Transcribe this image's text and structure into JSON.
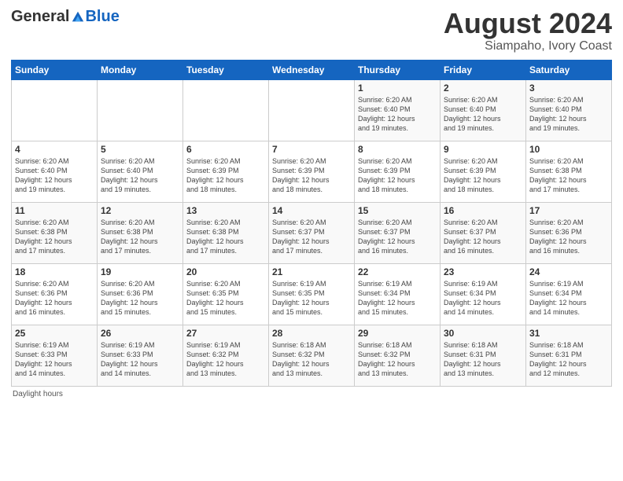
{
  "header": {
    "logo_general": "General",
    "logo_blue": "Blue",
    "month_title": "August 2024",
    "location": "Siampaho, Ivory Coast"
  },
  "days_of_week": [
    "Sunday",
    "Monday",
    "Tuesday",
    "Wednesday",
    "Thursday",
    "Friday",
    "Saturday"
  ],
  "weeks": [
    [
      {
        "day": "",
        "info": ""
      },
      {
        "day": "",
        "info": ""
      },
      {
        "day": "",
        "info": ""
      },
      {
        "day": "",
        "info": ""
      },
      {
        "day": "1",
        "info": "Sunrise: 6:20 AM\nSunset: 6:40 PM\nDaylight: 12 hours\nand 19 minutes."
      },
      {
        "day": "2",
        "info": "Sunrise: 6:20 AM\nSunset: 6:40 PM\nDaylight: 12 hours\nand 19 minutes."
      },
      {
        "day": "3",
        "info": "Sunrise: 6:20 AM\nSunset: 6:40 PM\nDaylight: 12 hours\nand 19 minutes."
      }
    ],
    [
      {
        "day": "4",
        "info": "Sunrise: 6:20 AM\nSunset: 6:40 PM\nDaylight: 12 hours\nand 19 minutes."
      },
      {
        "day": "5",
        "info": "Sunrise: 6:20 AM\nSunset: 6:40 PM\nDaylight: 12 hours\nand 19 minutes."
      },
      {
        "day": "6",
        "info": "Sunrise: 6:20 AM\nSunset: 6:39 PM\nDaylight: 12 hours\nand 18 minutes."
      },
      {
        "day": "7",
        "info": "Sunrise: 6:20 AM\nSunset: 6:39 PM\nDaylight: 12 hours\nand 18 minutes."
      },
      {
        "day": "8",
        "info": "Sunrise: 6:20 AM\nSunset: 6:39 PM\nDaylight: 12 hours\nand 18 minutes."
      },
      {
        "day": "9",
        "info": "Sunrise: 6:20 AM\nSunset: 6:39 PM\nDaylight: 12 hours\nand 18 minutes."
      },
      {
        "day": "10",
        "info": "Sunrise: 6:20 AM\nSunset: 6:38 PM\nDaylight: 12 hours\nand 17 minutes."
      }
    ],
    [
      {
        "day": "11",
        "info": "Sunrise: 6:20 AM\nSunset: 6:38 PM\nDaylight: 12 hours\nand 17 minutes."
      },
      {
        "day": "12",
        "info": "Sunrise: 6:20 AM\nSunset: 6:38 PM\nDaylight: 12 hours\nand 17 minutes."
      },
      {
        "day": "13",
        "info": "Sunrise: 6:20 AM\nSunset: 6:38 PM\nDaylight: 12 hours\nand 17 minutes."
      },
      {
        "day": "14",
        "info": "Sunrise: 6:20 AM\nSunset: 6:37 PM\nDaylight: 12 hours\nand 17 minutes."
      },
      {
        "day": "15",
        "info": "Sunrise: 6:20 AM\nSunset: 6:37 PM\nDaylight: 12 hours\nand 16 minutes."
      },
      {
        "day": "16",
        "info": "Sunrise: 6:20 AM\nSunset: 6:37 PM\nDaylight: 12 hours\nand 16 minutes."
      },
      {
        "day": "17",
        "info": "Sunrise: 6:20 AM\nSunset: 6:36 PM\nDaylight: 12 hours\nand 16 minutes."
      }
    ],
    [
      {
        "day": "18",
        "info": "Sunrise: 6:20 AM\nSunset: 6:36 PM\nDaylight: 12 hours\nand 16 minutes."
      },
      {
        "day": "19",
        "info": "Sunrise: 6:20 AM\nSunset: 6:36 PM\nDaylight: 12 hours\nand 15 minutes."
      },
      {
        "day": "20",
        "info": "Sunrise: 6:20 AM\nSunset: 6:35 PM\nDaylight: 12 hours\nand 15 minutes."
      },
      {
        "day": "21",
        "info": "Sunrise: 6:19 AM\nSunset: 6:35 PM\nDaylight: 12 hours\nand 15 minutes."
      },
      {
        "day": "22",
        "info": "Sunrise: 6:19 AM\nSunset: 6:34 PM\nDaylight: 12 hours\nand 15 minutes."
      },
      {
        "day": "23",
        "info": "Sunrise: 6:19 AM\nSunset: 6:34 PM\nDaylight: 12 hours\nand 14 minutes."
      },
      {
        "day": "24",
        "info": "Sunrise: 6:19 AM\nSunset: 6:34 PM\nDaylight: 12 hours\nand 14 minutes."
      }
    ],
    [
      {
        "day": "25",
        "info": "Sunrise: 6:19 AM\nSunset: 6:33 PM\nDaylight: 12 hours\nand 14 minutes."
      },
      {
        "day": "26",
        "info": "Sunrise: 6:19 AM\nSunset: 6:33 PM\nDaylight: 12 hours\nand 14 minutes."
      },
      {
        "day": "27",
        "info": "Sunrise: 6:19 AM\nSunset: 6:32 PM\nDaylight: 12 hours\nand 13 minutes."
      },
      {
        "day": "28",
        "info": "Sunrise: 6:18 AM\nSunset: 6:32 PM\nDaylight: 12 hours\nand 13 minutes."
      },
      {
        "day": "29",
        "info": "Sunrise: 6:18 AM\nSunset: 6:32 PM\nDaylight: 12 hours\nand 13 minutes."
      },
      {
        "day": "30",
        "info": "Sunrise: 6:18 AM\nSunset: 6:31 PM\nDaylight: 12 hours\nand 13 minutes."
      },
      {
        "day": "31",
        "info": "Sunrise: 6:18 AM\nSunset: 6:31 PM\nDaylight: 12 hours\nand 12 minutes."
      }
    ]
  ],
  "footer": {
    "label": "Daylight hours"
  }
}
